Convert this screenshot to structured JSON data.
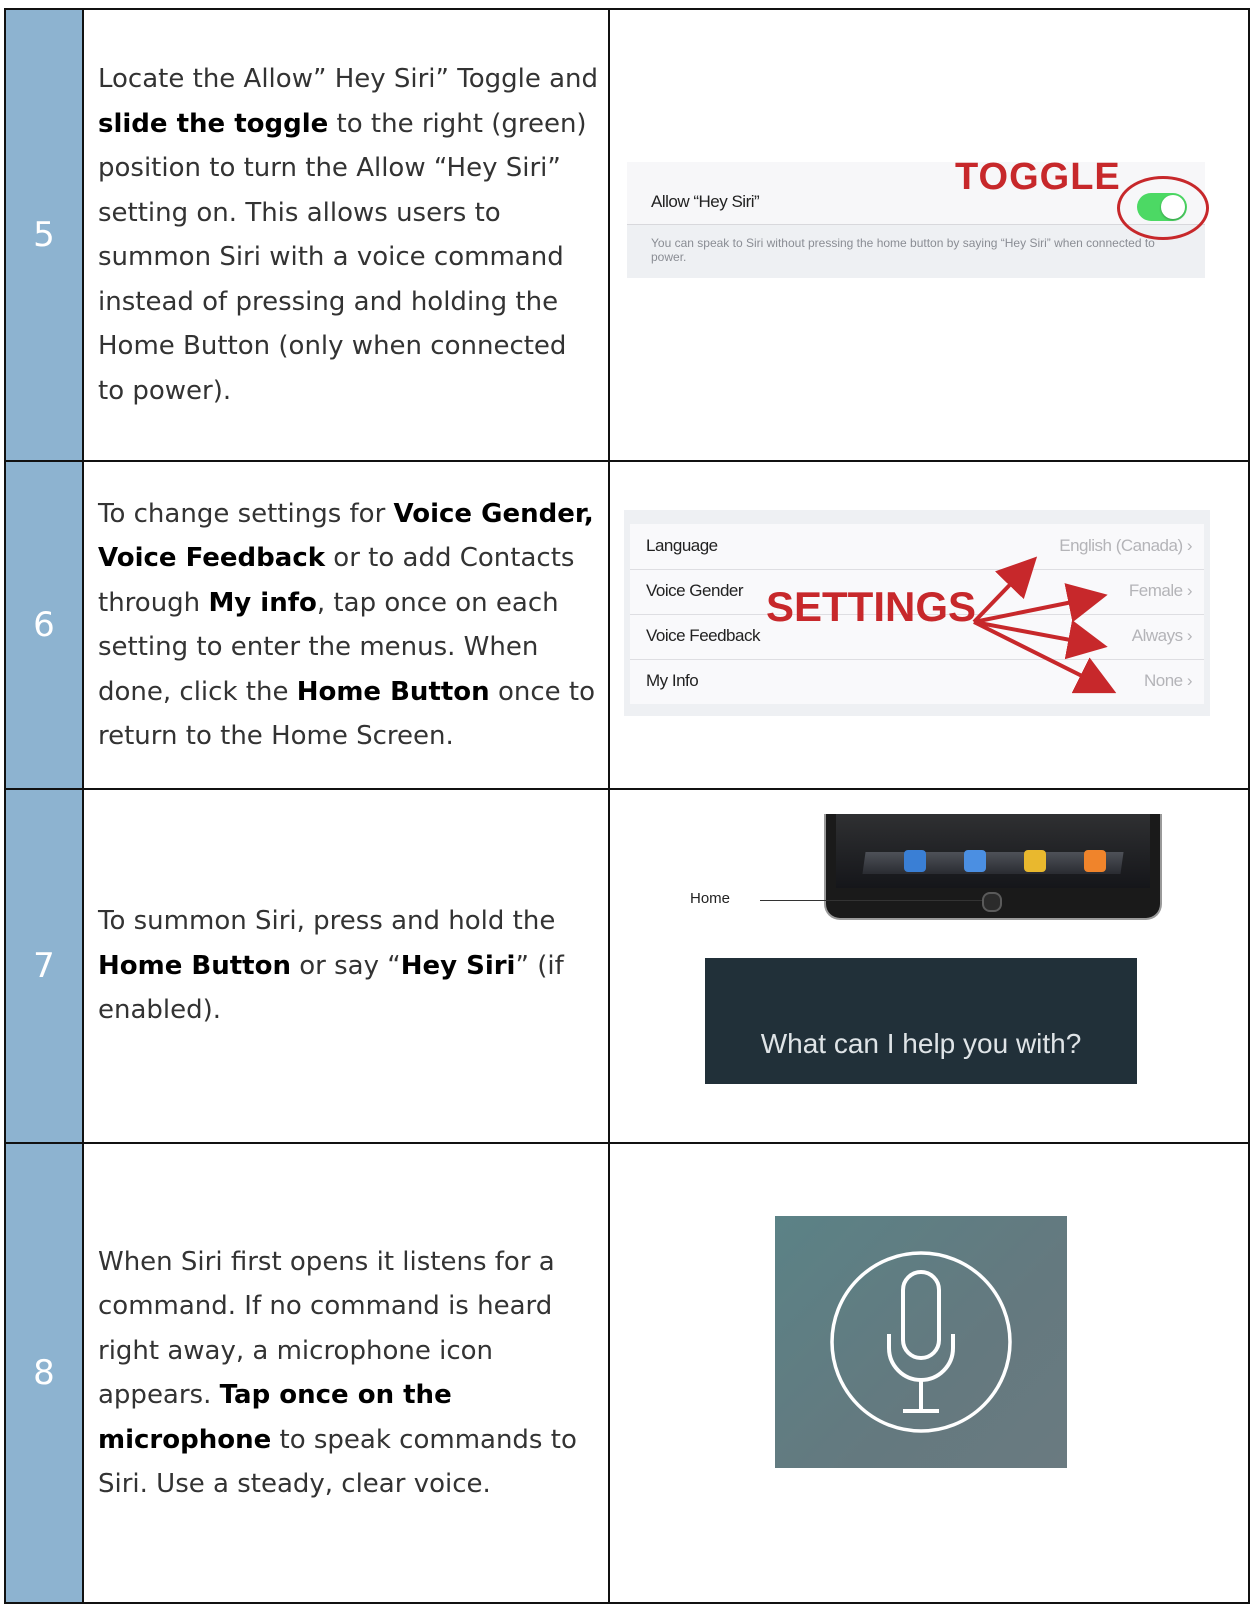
{
  "steps": [
    {
      "number": "5",
      "text": [
        {
          "t": "Locate the Allow” Hey Siri” Toggle and ",
          "b": false
        },
        {
          "t": "slide the toggle",
          "b": true
        },
        {
          "t": " to the right (green) position to turn the Allow “Hey Siri” setting on. This allows users to summon Siri with a voice command instead of pressing and holding the Home Button (only when connected to power).",
          "b": false
        }
      ]
    },
    {
      "number": "6",
      "text": [
        {
          "t": "To change settings for ",
          "b": false
        },
        {
          "t": "Voice Gender, Voice Feedback",
          "b": true
        },
        {
          "t": " or to add Contacts through ",
          "b": false
        },
        {
          "t": "My info",
          "b": true
        },
        {
          "t": ", tap once on each setting to enter the menus. When done, click the ",
          "b": false
        },
        {
          "t": "Home Button",
          "b": true
        },
        {
          "t": " once to return to the Home Screen.",
          "b": false
        }
      ]
    },
    {
      "number": "7",
      "text": [
        {
          "t": "To summon Siri, press and hold the ",
          "b": false
        },
        {
          "t": "Home Button",
          "b": true
        },
        {
          "t": " or say “",
          "b": false
        },
        {
          "t": "Hey Siri",
          "b": true
        },
        {
          "t": "” (if enabled).",
          "b": false
        }
      ]
    },
    {
      "number": "8",
      "text": [
        {
          "t": "When Siri first opens it listens for a command. If no command is heard right away, a microphone icon appears. ",
          "b": false
        },
        {
          "t": "Tap once on the microphone",
          "b": true
        },
        {
          "t": " to speak commands to Siri. Use a steady, clear voice.",
          "b": false
        }
      ]
    }
  ],
  "toggle_shot": {
    "annotation": "TOGGLE",
    "label": "Allow “Hey Siri”",
    "description": "You can speak to Siri without pressing the home button by saying “Hey Siri” when connected to power.",
    "toggle_on": true
  },
  "settings_shot": {
    "annotation": "SETTINGS",
    "rows": [
      {
        "label": "Language",
        "value": "English (Canada)"
      },
      {
        "label": "Voice Gender",
        "value": "Female"
      },
      {
        "label": "Voice Feedback",
        "value": "Always"
      },
      {
        "label": "My Info",
        "value": "None"
      }
    ]
  },
  "ipad_shot": {
    "label": "Home"
  },
  "siri_shot": {
    "prompt": "What can I help you with?"
  },
  "colors": {
    "number_column": "#8db3d0",
    "annotation_red": "#c7282b",
    "toggle_green": "#4cd964"
  }
}
